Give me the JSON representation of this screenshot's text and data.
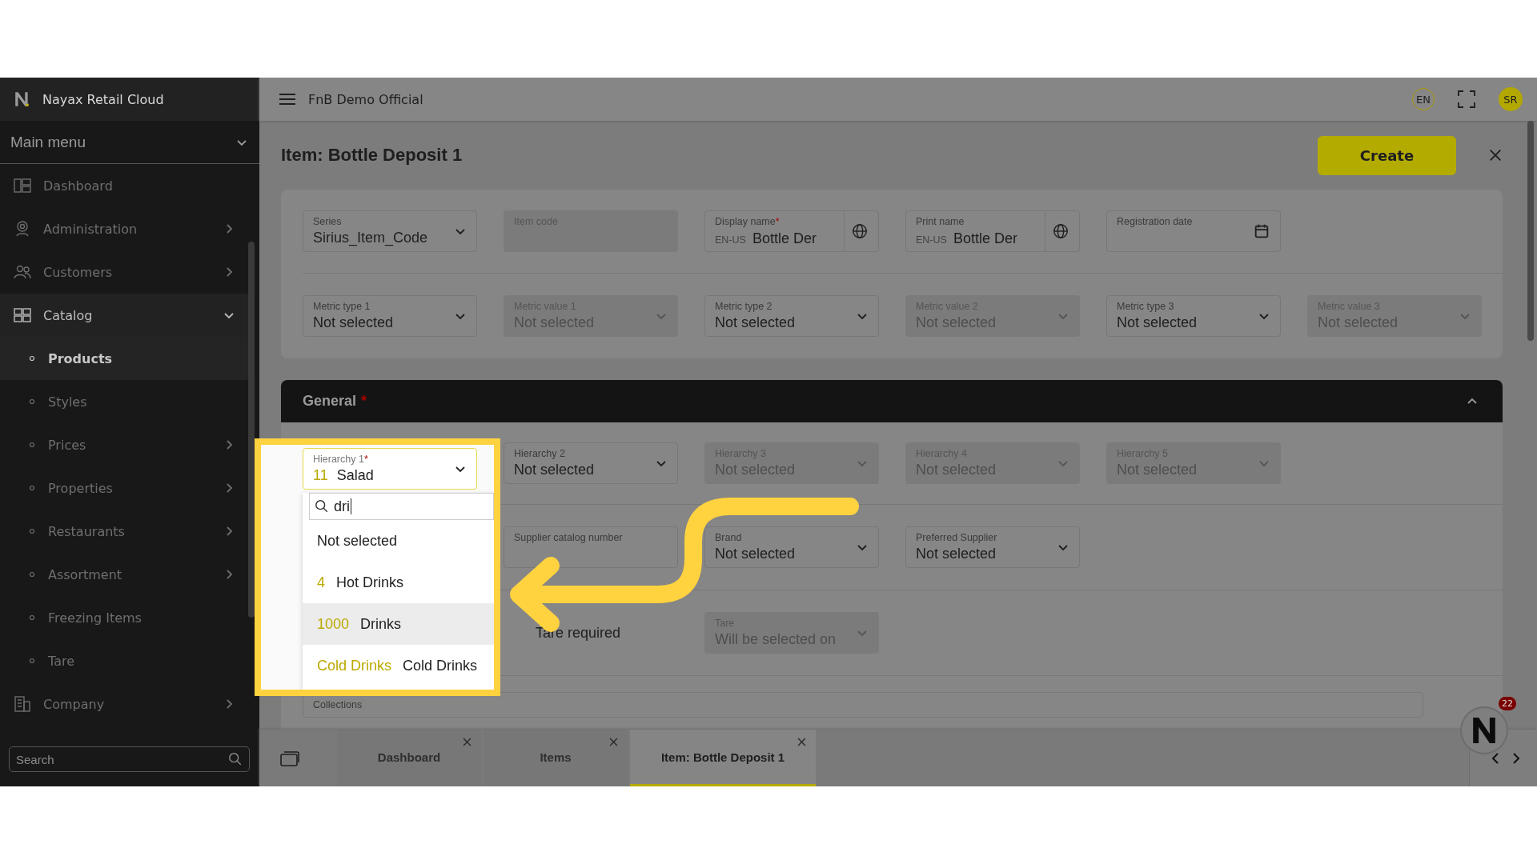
{
  "sidebar": {
    "brand": "Nayax Retail Cloud",
    "menu_title": "Main menu",
    "search_placeholder": "Search",
    "items": [
      {
        "label": "Dashboard",
        "selected": false
      },
      {
        "label": "Administration",
        "selected": false,
        "expanded": false
      },
      {
        "label": "Customers",
        "selected": false,
        "expanded": false
      },
      {
        "label": "Catalog",
        "selected": true,
        "expanded": true,
        "children": [
          {
            "label": "Products",
            "selected": true,
            "submenu": false
          },
          {
            "label": "Styles",
            "selected": false,
            "submenu": false
          },
          {
            "label": "Prices",
            "selected": false,
            "submenu": true
          },
          {
            "label": "Properties",
            "selected": false,
            "submenu": true
          },
          {
            "label": "Restaurants",
            "selected": false,
            "submenu": true
          },
          {
            "label": "Assortment",
            "selected": false,
            "submenu": true
          },
          {
            "label": "Freezing Items",
            "selected": false,
            "submenu": false
          },
          {
            "label": "Tare",
            "selected": false,
            "submenu": false
          }
        ]
      },
      {
        "label": "Company",
        "selected": false,
        "expanded": false
      }
    ]
  },
  "topbar": {
    "store": "FnB Demo Official",
    "language": "EN",
    "user_initials": "SR"
  },
  "page": {
    "title": "Item: Bottle Deposit 1",
    "create_button": "Create"
  },
  "header_rows": [
    [
      {
        "kind": "select",
        "label": "Series",
        "value": "Sirius_Item_Code",
        "disabled": false
      },
      {
        "kind": "text",
        "label": "Item code",
        "disabled": true
      },
      {
        "kind": "name",
        "label": "Display name",
        "required_mark": "*",
        "locale": "EN-US",
        "value": "Bottle Der",
        "disabled": false
      },
      {
        "kind": "name",
        "label": "Print name",
        "locale": "EN-US",
        "value": "Bottle Der",
        "disabled": false
      },
      {
        "kind": "date",
        "label": "Registration date",
        "disabled": false
      }
    ],
    [
      {
        "kind": "select",
        "label": "Metric type 1",
        "value": "Not selected",
        "disabled": false
      },
      {
        "kind": "select",
        "label": "Metric value 1",
        "value": "Not selected",
        "disabled": true
      },
      {
        "kind": "select",
        "label": "Metric type 2",
        "value": "Not selected",
        "disabled": false
      },
      {
        "kind": "select",
        "label": "Metric value 2",
        "value": "Not selected",
        "disabled": true
      },
      {
        "kind": "select",
        "label": "Metric type 3",
        "value": "Not selected",
        "disabled": false
      },
      {
        "kind": "select",
        "label": "Metric value 3",
        "value": "Not selected",
        "disabled": true
      }
    ]
  ],
  "general": {
    "title": "General",
    "required_mark": "*",
    "expanded": true,
    "hierarchy_open": {
      "label": "Hierarchy 1",
      "required_mark": "*",
      "code": "11",
      "value": "Salad",
      "search_value": "dri",
      "options": [
        {
          "label": "Not selected",
          "highlighted": false
        },
        {
          "code": "4",
          "label": "Hot Drinks",
          "highlighted": false
        },
        {
          "code": "1000",
          "label": "Drinks",
          "highlighted": true
        },
        {
          "code": "Cold Drinks",
          "label": "Cold Drinks",
          "highlighted": false
        }
      ]
    },
    "hierarchy": [
      {
        "kind": "select",
        "label": "Hierarchy 2",
        "value": "Not selected",
        "disabled": false
      },
      {
        "kind": "select",
        "label": "Hierarchy 3",
        "value": "Not selected",
        "disabled": true
      },
      {
        "kind": "select",
        "label": "Hierarchy 4",
        "value": "Not selected",
        "disabled": true
      },
      {
        "kind": "select",
        "label": "Hierarchy 5",
        "value": "Not selected",
        "disabled": true
      }
    ],
    "suppliers": [
      {
        "kind": "text",
        "label": "Supplier catalog number",
        "disabled": false
      },
      {
        "kind": "select",
        "label": "Brand",
        "value": "Not selected",
        "disabled": false
      },
      {
        "kind": "select",
        "label": "Preferred Supplier",
        "value": "Not selected",
        "disabled": false
      }
    ],
    "tare_label": "Tare required",
    "tare": {
      "kind": "select",
      "label": "Tare",
      "value": "Will be selected on",
      "disabled": true
    },
    "collections_label": "Collections"
  },
  "tabs": [
    {
      "label": "Dashboard",
      "selected": false
    },
    {
      "label": "Items",
      "selected": false
    },
    {
      "label": "Item: Bottle Deposit 1",
      "selected": true
    }
  ],
  "chat_badge": "22"
}
